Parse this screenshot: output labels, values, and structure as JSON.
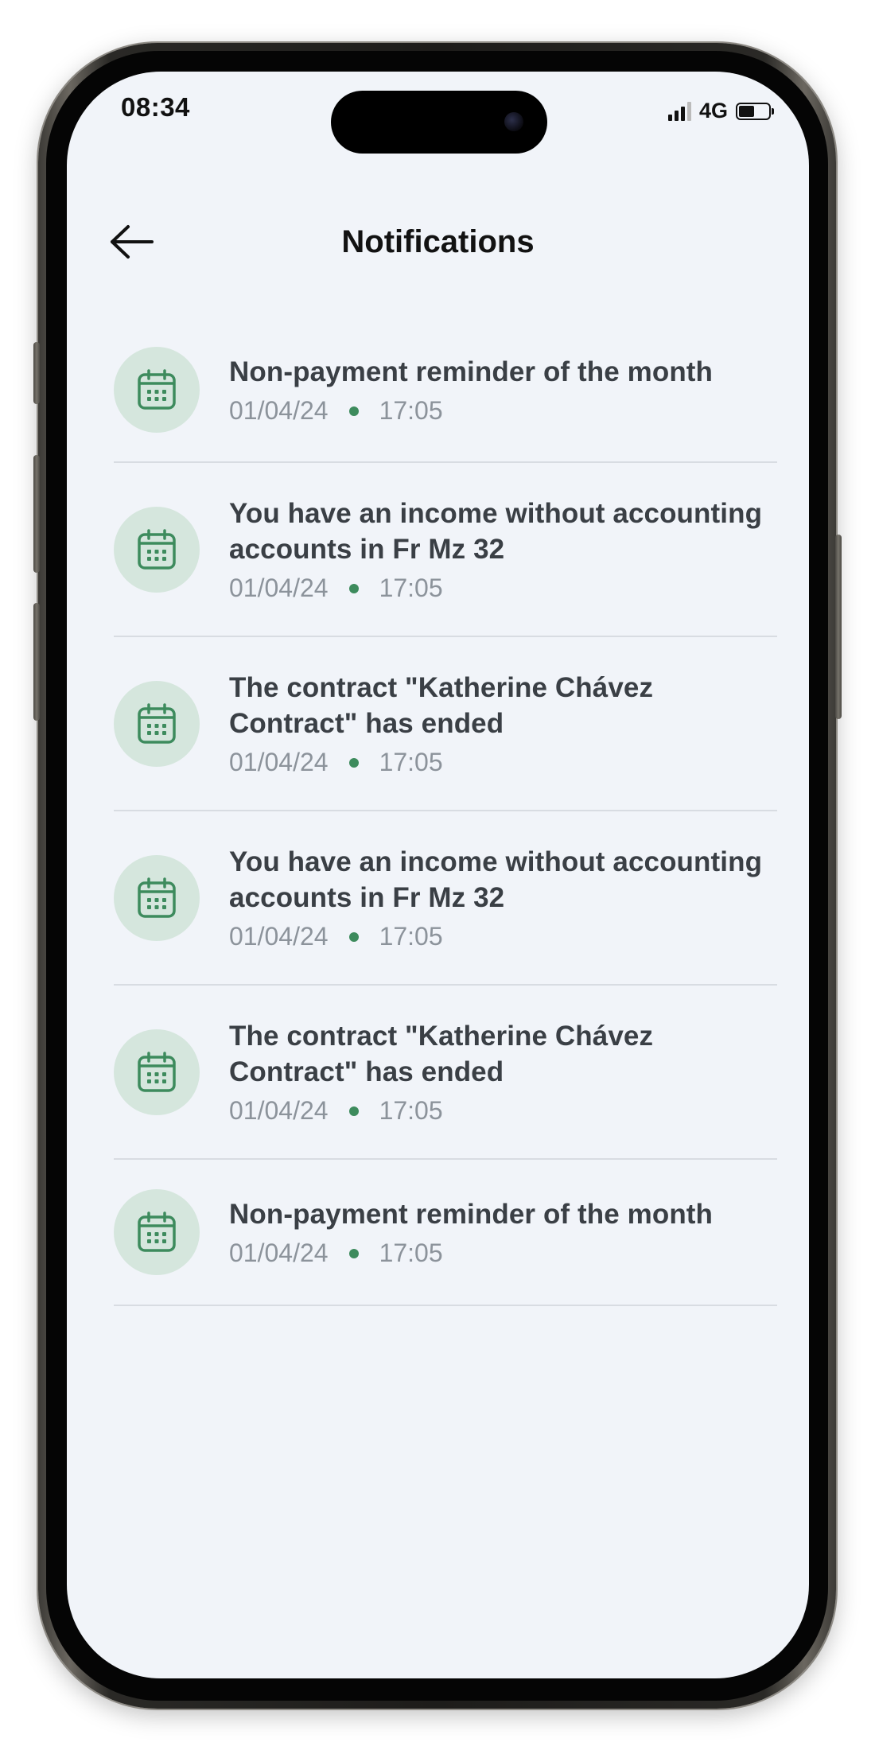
{
  "status_bar": {
    "time": "08:34",
    "network": "4G",
    "battery_level": 0.55
  },
  "header": {
    "title": "Notifications",
    "back_icon": "arrow-left-icon"
  },
  "colors": {
    "screen_bg": "#f1f4f9",
    "badge_bg": "#d5e6dd",
    "accent": "#3d8b5d",
    "title_text": "#3a3f45",
    "meta_text": "#8c939b"
  },
  "notifications": [
    {
      "icon": "calendar-icon",
      "title": "Non-payment reminder of the month",
      "date": "01/04/24",
      "time": "17:05"
    },
    {
      "icon": "calendar-icon",
      "title": "You have an income without accounting accounts in Fr Mz 32",
      "date": "01/04/24",
      "time": "17:05"
    },
    {
      "icon": "calendar-icon",
      "title": "The contract \"Katherine Chávez Contract\" has ended",
      "date": "01/04/24",
      "time": "17:05"
    },
    {
      "icon": "calendar-icon",
      "title": "You have an income without accounting accounts in Fr Mz 32",
      "date": "01/04/24",
      "time": "17:05"
    },
    {
      "icon": "calendar-icon",
      "title": "The contract \"Katherine Chávez Contract\" has ended",
      "date": "01/04/24",
      "time": "17:05"
    },
    {
      "icon": "calendar-icon",
      "title": "Non-payment reminder of the month",
      "date": "01/04/24",
      "time": "17:05"
    }
  ]
}
